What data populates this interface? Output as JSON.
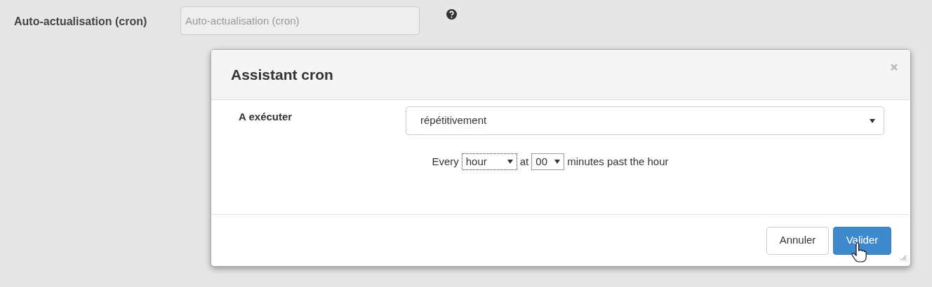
{
  "field": {
    "label": "Auto-actualisation (cron)",
    "placeholder": "Auto-actualisation (cron)"
  },
  "dialog": {
    "title": "Assistant cron",
    "row_label": "A exécuter",
    "mode": "répétitivement",
    "schedule": {
      "prefix": "Every",
      "unit": "hour",
      "unit_focused": true,
      "middle": "at",
      "minute": "00",
      "suffix": "minutes past the hour"
    },
    "buttons": [
      {
        "label": "Annuler",
        "kind": "default"
      },
      {
        "label": "Valider",
        "kind": "primary"
      }
    ]
  }
}
